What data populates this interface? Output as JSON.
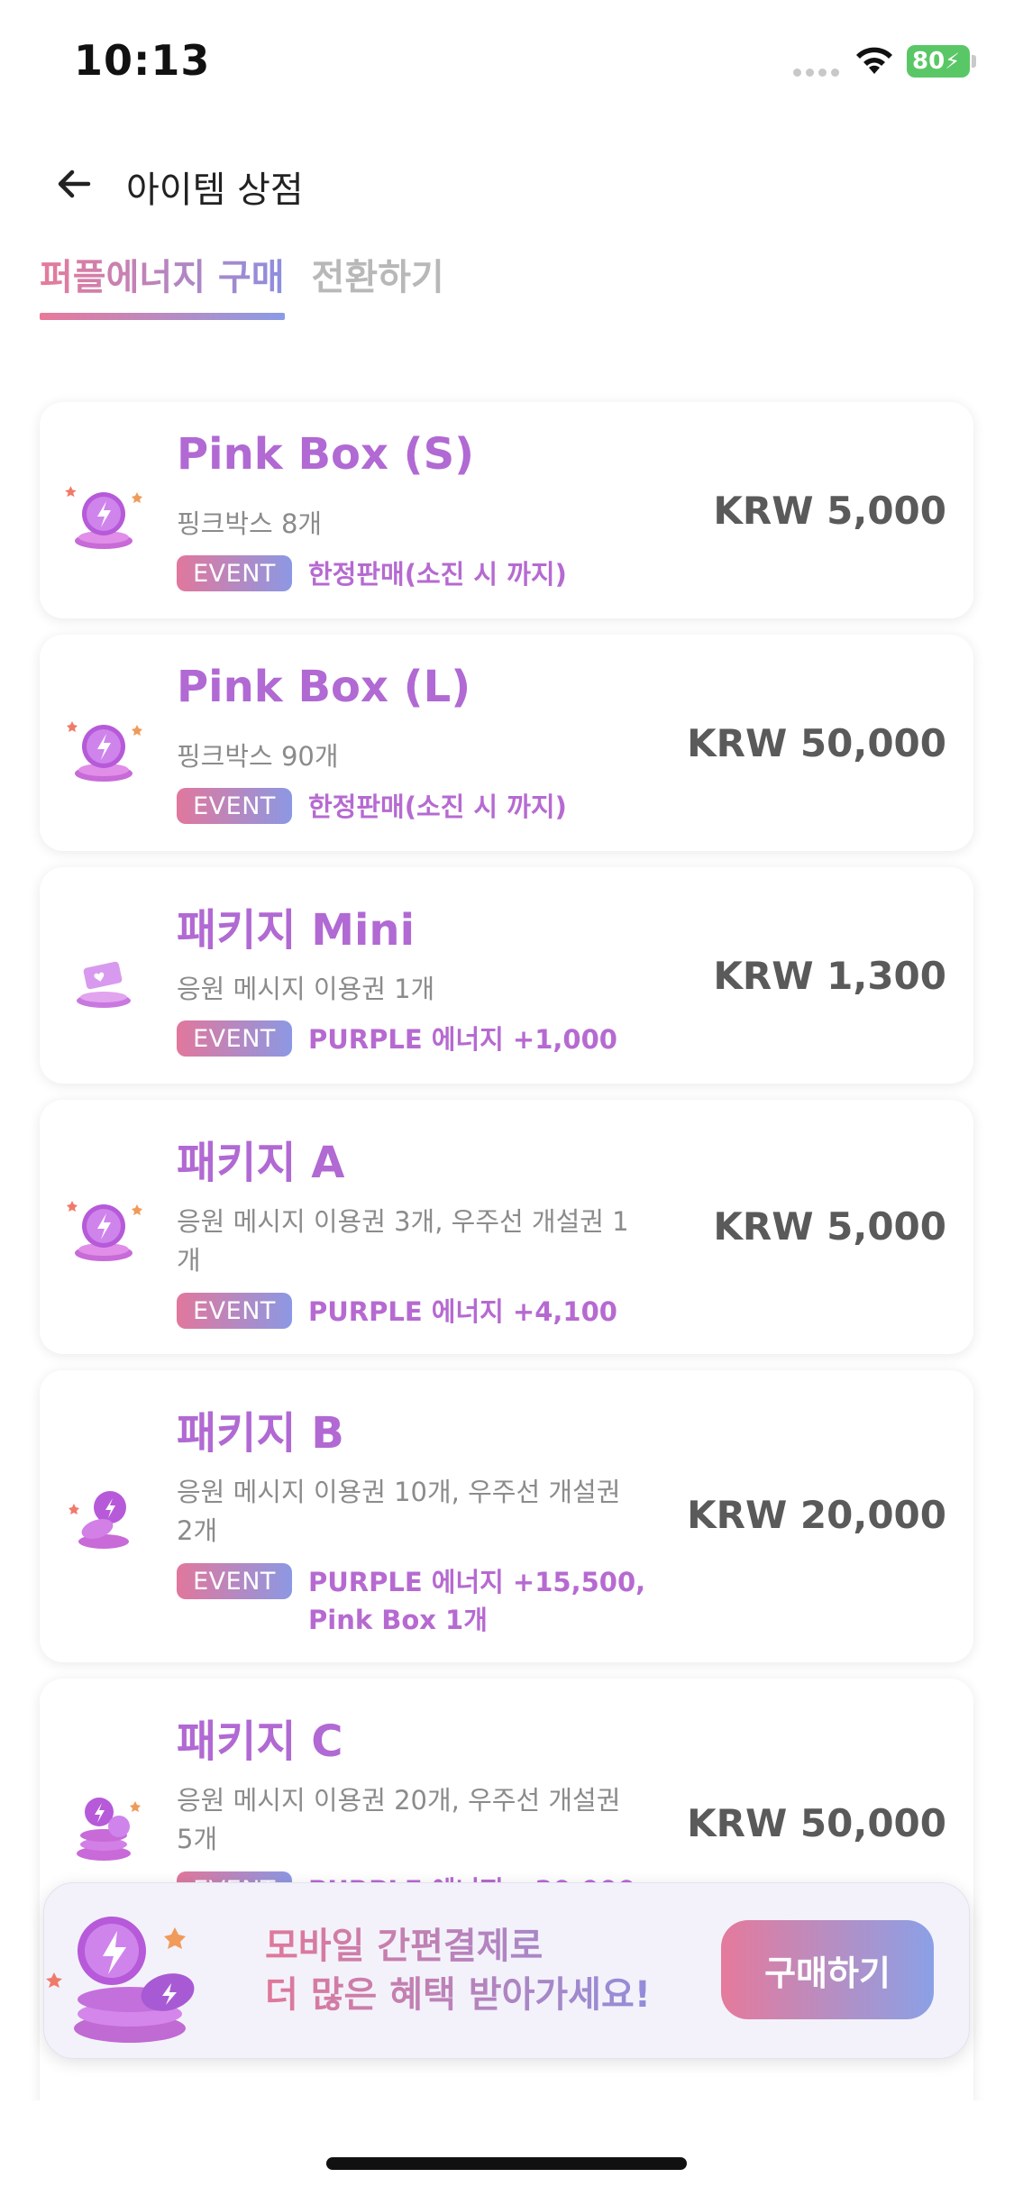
{
  "status": {
    "time": "10:13",
    "battery": "80"
  },
  "header": {
    "title": "아이템 상점"
  },
  "tabs": [
    {
      "label": "퍼플에너지 구매",
      "active": true
    },
    {
      "label": "전환하기",
      "active": false
    }
  ],
  "products": [
    {
      "name": "Pink Box (S)",
      "desc": "핑크박스 8개",
      "badge": "EVENT",
      "event": "한정판매(소진 시 까지)",
      "price": "KRW 5,000"
    },
    {
      "name": "Pink Box (L)",
      "desc": "핑크박스 90개",
      "badge": "EVENT",
      "event": "한정판매(소진 시 까지)",
      "price": "KRW 50,000"
    },
    {
      "name": "패키지 Mini",
      "desc": "응원 메시지 이용권 1개",
      "badge": "EVENT",
      "event": "PURPLE 에너지 +1,000",
      "price": "KRW 1,300"
    },
    {
      "name": "패키지 A",
      "desc": "응원 메시지 이용권 3개, 우주선 개설권 1개",
      "badge": "EVENT",
      "event": "PURPLE 에너지 +4,100",
      "price": "KRW 5,000"
    },
    {
      "name": "패키지 B",
      "desc": "응원 메시지 이용권 10개, 우주선 개설권 2개",
      "badge": "EVENT",
      "event": "PURPLE 에너지 +15,500, Pink Box 1개",
      "price": "KRW 20,000"
    },
    {
      "name": "패키지 C",
      "desc": "응원 메시지 이용권 20개, 우주선 개설권 5개",
      "badge": "EVENT",
      "event": "PURPLE 에너지 +30,000",
      "price": "KRW 50,000"
    }
  ],
  "promo": {
    "line1": "모바일 간편결제로",
    "line2": "더 많은 혜택 받아가세요!",
    "button": "구매하기"
  },
  "colors": {
    "accent_pink": "#e57a9c",
    "accent_blue": "#8ba0e6",
    "product_purple": "#b169d3"
  },
  "icons": [
    "back-arrow-icon",
    "energy-coin-icon",
    "ticket-icon",
    "wifi-icon",
    "battery-icon"
  ]
}
